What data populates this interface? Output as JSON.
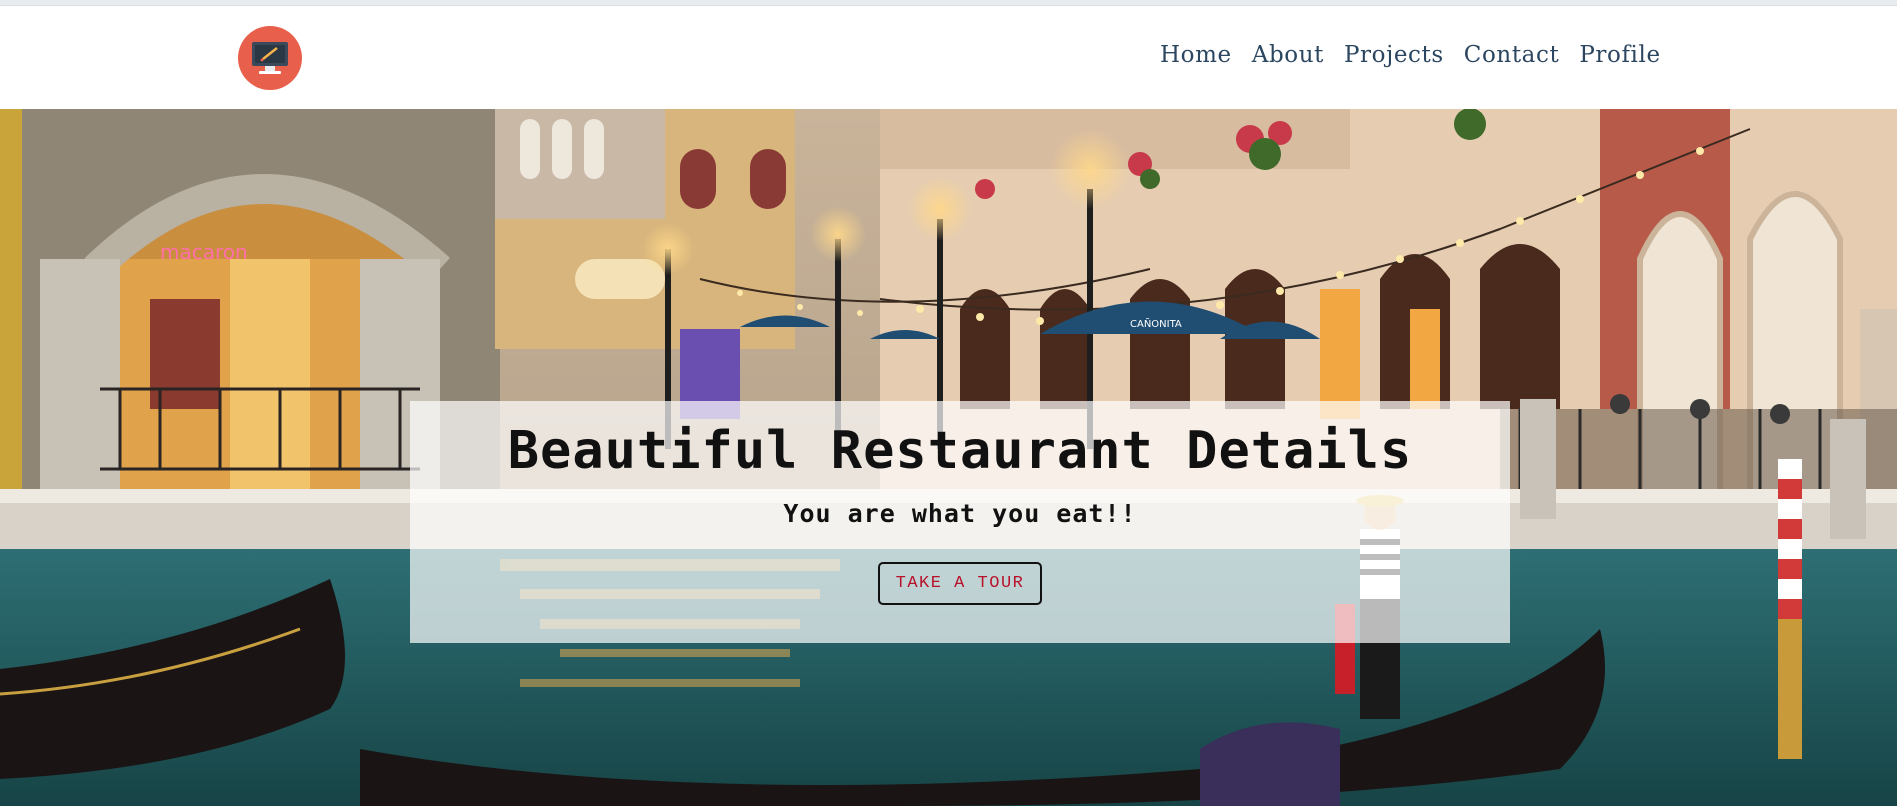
{
  "nav": {
    "logo_icon": "desktop-computer-icon",
    "links": [
      "Home",
      "About",
      "Projects",
      "Contact",
      "Profile"
    ]
  },
  "hero": {
    "title": "Beautiful Restaurant Details",
    "subtitle": "You are what you eat!!",
    "button_label": "TAKE A TOUR",
    "umbrella_text": "CAÑONITA"
  },
  "colors": {
    "logo_bg": "#e8604c",
    "nav_text": "#2c4660",
    "button_text": "#b8112a"
  }
}
